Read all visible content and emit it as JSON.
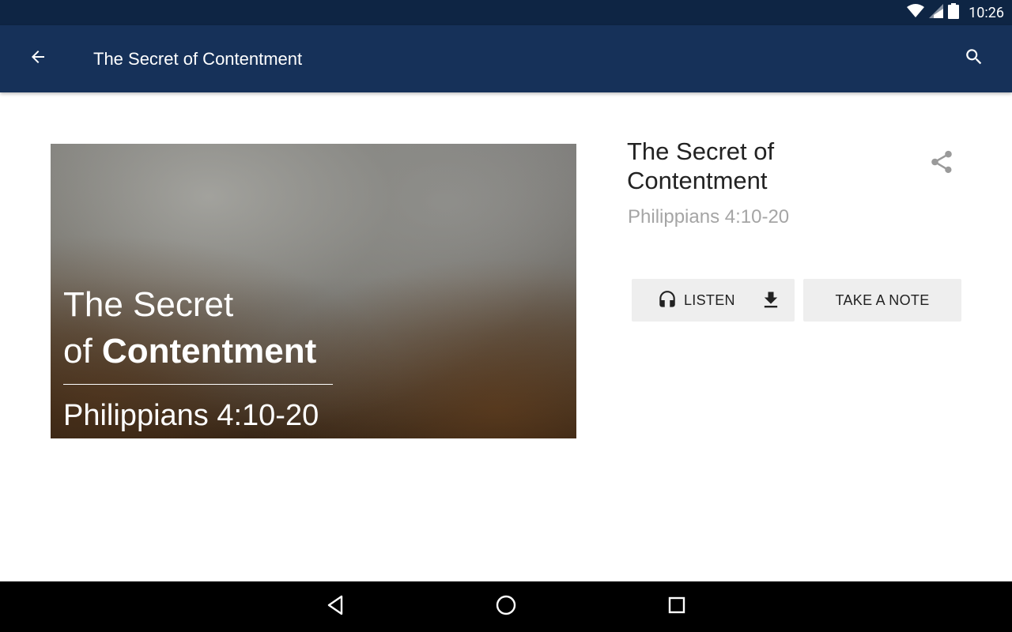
{
  "status": {
    "time": "10:26"
  },
  "app_bar": {
    "title": "The Secret of Contentment"
  },
  "hero": {
    "line1": "The Secret",
    "line2_prefix": "of ",
    "line2_bold": "Contentment",
    "reference": "Philippians 4:10-20"
  },
  "detail": {
    "title": "The Secret of Contentment",
    "subtitle": "Philippians 4:10-20"
  },
  "actions": {
    "listen_label": "LISTEN",
    "note_label": "TAKE A NOTE"
  },
  "colors": {
    "status_bar": "#0e2544",
    "app_bar": "#163159",
    "button_bg": "#eeeeee",
    "subtitle": "#a5a5a5"
  }
}
